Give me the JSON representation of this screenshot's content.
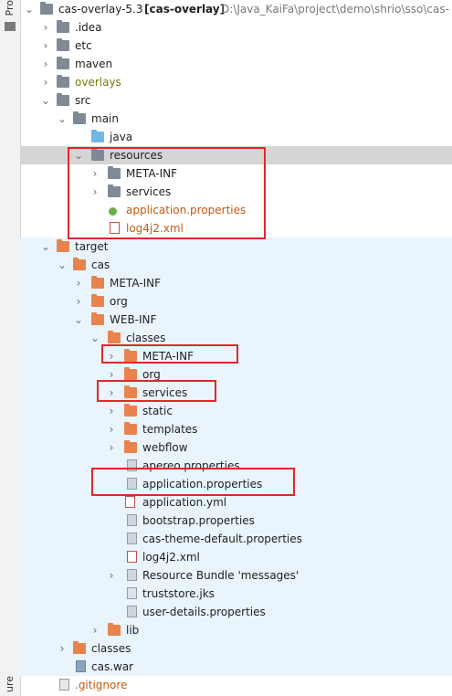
{
  "gutter": {
    "top_label": "Pro",
    "bottom_label": "ure"
  },
  "tree": {
    "root": {
      "name": "cas-overlay-5.3",
      "module": "[cas-overlay]",
      "path": "D:\\Java_KaiFa\\project\\demo\\shrio\\sso\\cas-"
    },
    "rows": [
      {
        "label": ".idea"
      },
      {
        "label": "etc"
      },
      {
        "label": "maven"
      },
      {
        "label": "overlays"
      },
      {
        "label": "src"
      },
      {
        "label": "main"
      },
      {
        "label": "java"
      },
      {
        "label": "resources"
      },
      {
        "label": "META-INF"
      },
      {
        "label": "services"
      },
      {
        "label": "application.properties"
      },
      {
        "label": "log4j2.xml"
      },
      {
        "label": "target"
      },
      {
        "label": "cas"
      },
      {
        "label": "META-INF"
      },
      {
        "label": "org"
      },
      {
        "label": "WEB-INF"
      },
      {
        "label": "classes"
      },
      {
        "label": "META-INF"
      },
      {
        "label": "org"
      },
      {
        "label": "services"
      },
      {
        "label": "static"
      },
      {
        "label": "templates"
      },
      {
        "label": "webflow"
      },
      {
        "label": "apereo.properties"
      },
      {
        "label": "application.properties"
      },
      {
        "label": "application.yml"
      },
      {
        "label": "bootstrap.properties"
      },
      {
        "label": "cas-theme-default.properties"
      },
      {
        "label": "log4j2.xml"
      },
      {
        "label": "Resource Bundle 'messages'"
      },
      {
        "label": "truststore.jks"
      },
      {
        "label": "user-details.properties"
      },
      {
        "label": "lib"
      },
      {
        "label": "classes"
      },
      {
        "label": "cas.war"
      },
      {
        "label": ".gitignore"
      }
    ]
  },
  "icons": {
    "expanded": "chevron-down-icon",
    "collapsed": "chevron-right-icon",
    "folder": "folder-icon",
    "file": "file-icon"
  },
  "colors": {
    "selected_row": "#d5d5d5",
    "target_area": "#e9f4fc",
    "excluded_folder": "#e8834e",
    "source_folder": "#6fb8e6",
    "highlight_box": "#e3262b"
  }
}
